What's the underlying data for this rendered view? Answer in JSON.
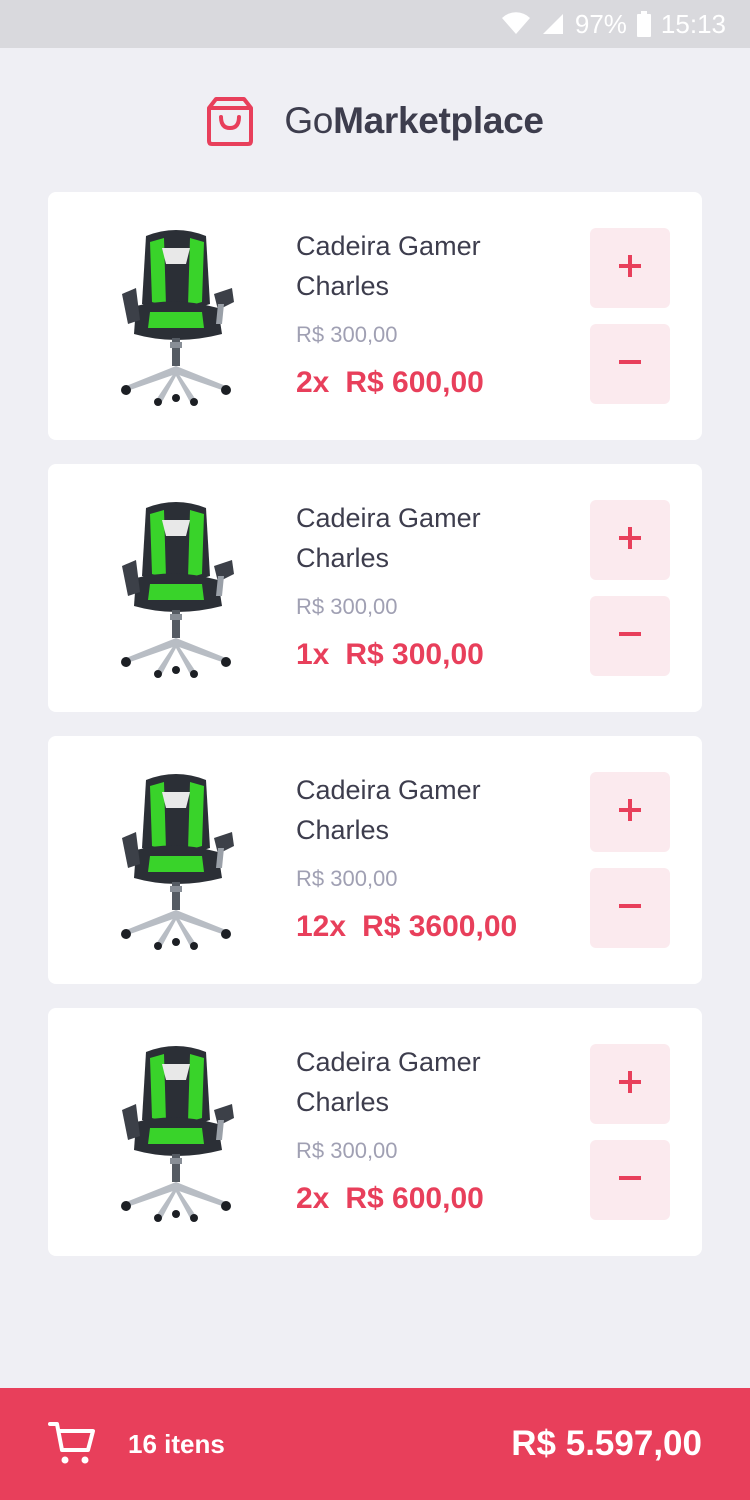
{
  "status_bar": {
    "battery": "97%",
    "time": "15:13",
    "icons": [
      "wifi-icon",
      "signal-icon",
      "battery-icon"
    ]
  },
  "header": {
    "title_light": "Go",
    "title_bold": "Marketplace",
    "icon": "shopping-bag-icon"
  },
  "colors": {
    "accent": "#e83f5b",
    "button_bg": "#fbeaee",
    "text": "#3d3d4d",
    "muted": "#a0a0b3",
    "background": "#efeff4"
  },
  "cart": {
    "items": [
      {
        "title": "Cadeira Gamer Charles",
        "price": "R$ 300,00",
        "qty": "2x",
        "subtotal": "R$ 600,00"
      },
      {
        "title": "Cadeira Gamer Charles",
        "price": "R$ 300,00",
        "qty": "1x",
        "subtotal": "R$ 300,00"
      },
      {
        "title": "Cadeira Gamer Charles",
        "price": "R$ 300,00",
        "qty": "12x",
        "subtotal": "R$ 3600,00"
      },
      {
        "title": "Cadeira Gamer Charles",
        "price": "R$ 300,00",
        "qty": "2x",
        "subtotal": "R$ 600,00"
      }
    ]
  },
  "footer": {
    "items_count": "16 itens",
    "total": "R$ 5.597,00",
    "icon": "cart-icon"
  }
}
